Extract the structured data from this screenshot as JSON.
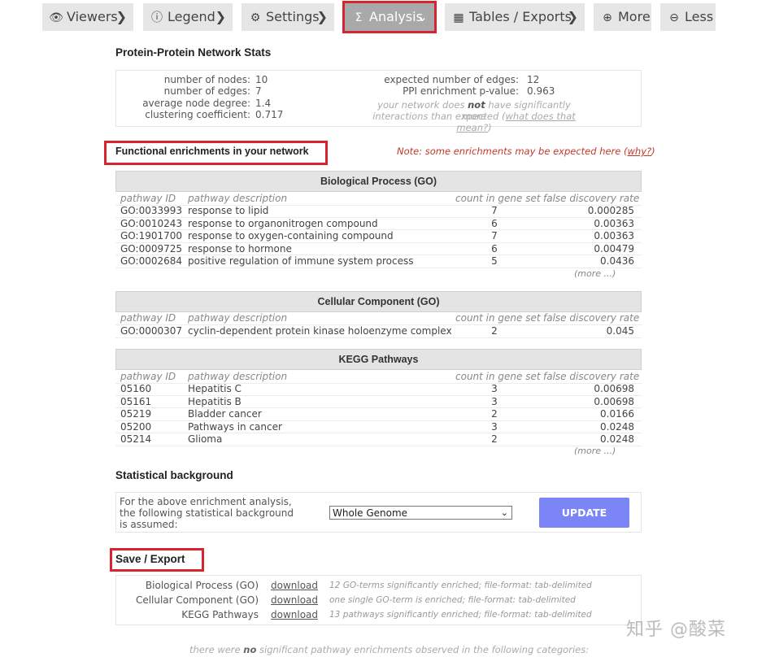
{
  "tabs": [
    {
      "label": "Viewers",
      "icon": "eye-icon",
      "glyph": "👁",
      "chev": "❯"
    },
    {
      "label": "Legend",
      "icon": "info-icon",
      "glyph": "ⓘ",
      "chev": "❯"
    },
    {
      "label": "Settings",
      "icon": "gear-icon",
      "glyph": "⚙",
      "chev": "❯"
    },
    {
      "label": "Analysis",
      "icon": "sigma-icon",
      "glyph": "Σ",
      "chev": "⌄"
    },
    {
      "label": "Tables / Exports",
      "icon": "table-icon",
      "glyph": "▦",
      "chev": "❯"
    },
    {
      "label": "More",
      "icon": "plus-icon",
      "glyph": "⊕",
      "chev": ""
    },
    {
      "label": "Less",
      "icon": "minus-icon",
      "glyph": "⊖",
      "chev": ""
    }
  ],
  "network_stats": {
    "title": "Protein-Protein Network Stats",
    "left": [
      {
        "label": "number of nodes:",
        "value": "10"
      },
      {
        "label": "number of edges:",
        "value": "7"
      },
      {
        "label": "average node degree:",
        "value": "1.4"
      },
      {
        "label": "clustering coefficient:",
        "value": "0.717"
      }
    ],
    "right": [
      {
        "label": "expected number of edges:",
        "value": "12"
      },
      {
        "label": "PPI enrichment p-value:",
        "value": "0.963"
      }
    ],
    "note_part1": "your network does ",
    "note_bold": "not",
    "note_part2": " have significantly more",
    "note_line2": "interactions than expected (",
    "note_link": "what does that mean?",
    "note_end": ")"
  },
  "enrichment": {
    "title": "Functional enrichments in your network",
    "note": "Note: some enrichments may be expected here (",
    "note_link": "why?",
    "note_end": ")",
    "headers": {
      "id": "pathway ID",
      "desc": "pathway description",
      "count": "count in gene set",
      "fdr": "false discovery rate"
    },
    "more": "(more ...)",
    "bp_title": "Biological Process (GO)",
    "bp_rows": [
      [
        "GO:0033993",
        "response to lipid",
        "7",
        "0.000285"
      ],
      [
        "GO:0010243",
        "response to organonitrogen compound",
        "6",
        "0.00363"
      ],
      [
        "GO:1901700",
        "response to oxygen-containing compound",
        "7",
        "0.00363"
      ],
      [
        "GO:0009725",
        "response to hormone",
        "6",
        "0.00479"
      ],
      [
        "GO:0002684",
        "positive regulation of immune system process",
        "5",
        "0.0436"
      ]
    ],
    "cc_title": "Cellular Component (GO)",
    "cc_rows": [
      [
        "GO:0000307",
        "cyclin-dependent protein kinase holoenzyme complex",
        "2",
        "0.045"
      ]
    ],
    "kegg_title": "KEGG Pathways",
    "kegg_rows": [
      [
        "05160",
        "Hepatitis C",
        "3",
        "0.00698"
      ],
      [
        "05161",
        "Hepatitis B",
        "3",
        "0.00698"
      ],
      [
        "05219",
        "Bladder cancer",
        "2",
        "0.0166"
      ],
      [
        "05200",
        "Pathways in cancer",
        "3",
        "0.0248"
      ],
      [
        "05214",
        "Glioma",
        "2",
        "0.0248"
      ]
    ]
  },
  "background": {
    "title": "Statistical background",
    "text1": "For the above enrichment analysis,",
    "text2": "the following statistical background",
    "text3": "is assumed:",
    "select_value": "Whole Genome",
    "update_label": "UPDATE"
  },
  "export": {
    "title": "Save / Export",
    "rows": [
      {
        "label": "Biological Process (GO)",
        "link": "download",
        "note": "12 GO-terms significantly enriched; file-format: tab-delimited"
      },
      {
        "label": "Cellular Component (GO)",
        "link": "download",
        "note": "one single GO-term is enriched; file-format: tab-delimited"
      },
      {
        "label": "KEGG Pathways",
        "link": "download",
        "note": "13 pathways significantly enriched; file-format: tab-delimited"
      }
    ]
  },
  "footer": {
    "part1": "there were ",
    "bold": "no",
    "part2": " significant pathway enrichments observed in the following categories:"
  },
  "watermark": "知乎 @酸菜",
  "colors": {
    "highlight": "#d9232d",
    "button": "#7b85f5",
    "tab_bg": "#e6e6e6",
    "tab_active": "#a9a9a9"
  }
}
